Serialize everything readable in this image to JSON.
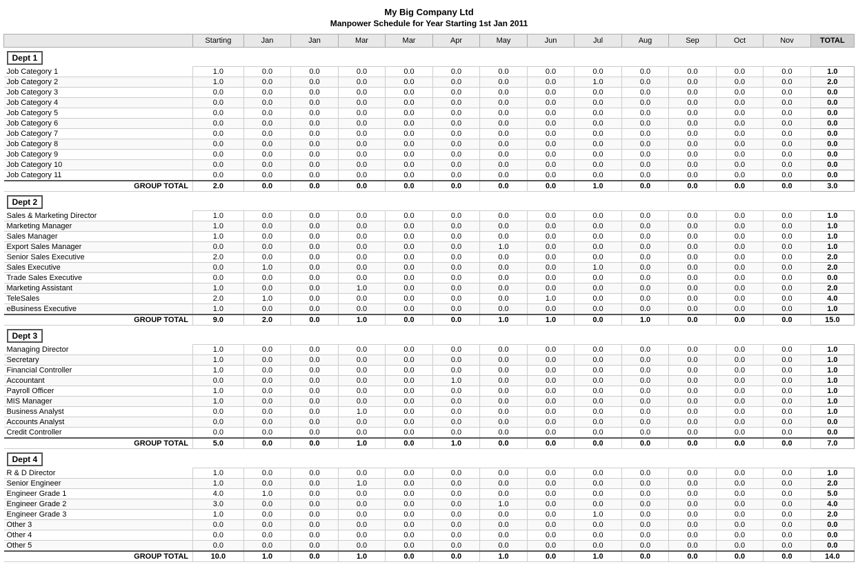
{
  "header": {
    "title": "My Big Company Ltd",
    "subtitle": "Manpower Schedule for Year Starting 1st Jan 2011"
  },
  "columns": [
    "Starting",
    "Jan",
    "Jan",
    "Mar",
    "Mar",
    "Apr",
    "May",
    "Jun",
    "Jul",
    "Aug",
    "Sep",
    "Oct",
    "Nov",
    "TOTAL"
  ],
  "dept1": {
    "name": "Dept 1",
    "rows": [
      {
        "label": "Job Category 1",
        "vals": [
          1.0,
          0.0,
          0.0,
          0.0,
          0.0,
          0.0,
          0.0,
          0.0,
          0.0,
          0.0,
          0.0,
          0.0,
          0.0,
          1.0
        ]
      },
      {
        "label": "Job Category 2",
        "vals": [
          1.0,
          0.0,
          0.0,
          0.0,
          0.0,
          0.0,
          0.0,
          0.0,
          1.0,
          0.0,
          0.0,
          0.0,
          0.0,
          2.0
        ]
      },
      {
        "label": "Job Category 3",
        "vals": [
          0.0,
          0.0,
          0.0,
          0.0,
          0.0,
          0.0,
          0.0,
          0.0,
          0.0,
          0.0,
          0.0,
          0.0,
          0.0,
          0.0
        ]
      },
      {
        "label": "Job Category 4",
        "vals": [
          0.0,
          0.0,
          0.0,
          0.0,
          0.0,
          0.0,
          0.0,
          0.0,
          0.0,
          0.0,
          0.0,
          0.0,
          0.0,
          0.0
        ]
      },
      {
        "label": "Job Category 5",
        "vals": [
          0.0,
          0.0,
          0.0,
          0.0,
          0.0,
          0.0,
          0.0,
          0.0,
          0.0,
          0.0,
          0.0,
          0.0,
          0.0,
          0.0
        ]
      },
      {
        "label": "Job Category 6",
        "vals": [
          0.0,
          0.0,
          0.0,
          0.0,
          0.0,
          0.0,
          0.0,
          0.0,
          0.0,
          0.0,
          0.0,
          0.0,
          0.0,
          0.0
        ]
      },
      {
        "label": "Job Category 7",
        "vals": [
          0.0,
          0.0,
          0.0,
          0.0,
          0.0,
          0.0,
          0.0,
          0.0,
          0.0,
          0.0,
          0.0,
          0.0,
          0.0,
          0.0
        ]
      },
      {
        "label": "Job Category 8",
        "vals": [
          0.0,
          0.0,
          0.0,
          0.0,
          0.0,
          0.0,
          0.0,
          0.0,
          0.0,
          0.0,
          0.0,
          0.0,
          0.0,
          0.0
        ]
      },
      {
        "label": "Job Category 9",
        "vals": [
          0.0,
          0.0,
          0.0,
          0.0,
          0.0,
          0.0,
          0.0,
          0.0,
          0.0,
          0.0,
          0.0,
          0.0,
          0.0,
          0.0
        ]
      },
      {
        "label": "Job Category 10",
        "vals": [
          0.0,
          0.0,
          0.0,
          0.0,
          0.0,
          0.0,
          0.0,
          0.0,
          0.0,
          0.0,
          0.0,
          0.0,
          0.0,
          0.0
        ]
      },
      {
        "label": "Job Category 11",
        "vals": [
          0.0,
          0.0,
          0.0,
          0.0,
          0.0,
          0.0,
          0.0,
          0.0,
          0.0,
          0.0,
          0.0,
          0.0,
          0.0,
          0.0
        ]
      }
    ],
    "total": {
      "label": "GROUP TOTAL",
      "vals": [
        2.0,
        0.0,
        0.0,
        0.0,
        0.0,
        0.0,
        0.0,
        0.0,
        1.0,
        0.0,
        0.0,
        0.0,
        0.0,
        3.0
      ]
    }
  },
  "dept2": {
    "name": "Dept 2",
    "rows": [
      {
        "label": "Sales & Marketing Director",
        "vals": [
          1.0,
          0.0,
          0.0,
          0.0,
          0.0,
          0.0,
          0.0,
          0.0,
          0.0,
          0.0,
          0.0,
          0.0,
          0.0,
          1.0
        ]
      },
      {
        "label": "Marketing Manager",
        "vals": [
          1.0,
          0.0,
          0.0,
          0.0,
          0.0,
          0.0,
          0.0,
          0.0,
          0.0,
          0.0,
          0.0,
          0.0,
          0.0,
          1.0
        ]
      },
      {
        "label": "Sales Manager",
        "vals": [
          1.0,
          0.0,
          0.0,
          0.0,
          0.0,
          0.0,
          0.0,
          0.0,
          0.0,
          0.0,
          0.0,
          0.0,
          0.0,
          1.0
        ]
      },
      {
        "label": "Export Sales Manager",
        "vals": [
          0.0,
          0.0,
          0.0,
          0.0,
          0.0,
          0.0,
          1.0,
          0.0,
          0.0,
          0.0,
          0.0,
          0.0,
          0.0,
          1.0
        ]
      },
      {
        "label": "Senior Sales Executive",
        "vals": [
          2.0,
          0.0,
          0.0,
          0.0,
          0.0,
          0.0,
          0.0,
          0.0,
          0.0,
          0.0,
          0.0,
          0.0,
          0.0,
          2.0
        ]
      },
      {
        "label": "Sales Executive",
        "vals": [
          0.0,
          1.0,
          0.0,
          0.0,
          0.0,
          0.0,
          0.0,
          0.0,
          1.0,
          0.0,
          0.0,
          0.0,
          0.0,
          2.0
        ]
      },
      {
        "label": "Trade Sales Executive",
        "vals": [
          0.0,
          0.0,
          0.0,
          0.0,
          0.0,
          0.0,
          0.0,
          0.0,
          0.0,
          0.0,
          0.0,
          0.0,
          0.0,
          0.0
        ]
      },
      {
        "label": "Marketing Assistant",
        "vals": [
          1.0,
          0.0,
          0.0,
          1.0,
          0.0,
          0.0,
          0.0,
          0.0,
          0.0,
          0.0,
          0.0,
          0.0,
          0.0,
          2.0
        ]
      },
      {
        "label": "TeleSales",
        "vals": [
          2.0,
          1.0,
          0.0,
          0.0,
          0.0,
          0.0,
          0.0,
          1.0,
          0.0,
          0.0,
          0.0,
          0.0,
          0.0,
          4.0
        ]
      },
      {
        "label": "eBusiness Executive",
        "vals": [
          1.0,
          0.0,
          0.0,
          0.0,
          0.0,
          0.0,
          0.0,
          0.0,
          0.0,
          0.0,
          0.0,
          0.0,
          0.0,
          1.0
        ]
      }
    ],
    "total": {
      "label": "GROUP TOTAL",
      "vals": [
        9.0,
        2.0,
        0.0,
        1.0,
        0.0,
        0.0,
        1.0,
        1.0,
        0.0,
        1.0,
        0.0,
        0.0,
        0.0,
        15.0
      ]
    }
  },
  "dept3": {
    "name": "Dept 3",
    "rows": [
      {
        "label": "Managing Director",
        "vals": [
          1.0,
          0.0,
          0.0,
          0.0,
          0.0,
          0.0,
          0.0,
          0.0,
          0.0,
          0.0,
          0.0,
          0.0,
          0.0,
          1.0
        ]
      },
      {
        "label": "Secretary",
        "vals": [
          1.0,
          0.0,
          0.0,
          0.0,
          0.0,
          0.0,
          0.0,
          0.0,
          0.0,
          0.0,
          0.0,
          0.0,
          0.0,
          1.0
        ]
      },
      {
        "label": "Financial Controller",
        "vals": [
          1.0,
          0.0,
          0.0,
          0.0,
          0.0,
          0.0,
          0.0,
          0.0,
          0.0,
          0.0,
          0.0,
          0.0,
          0.0,
          1.0
        ]
      },
      {
        "label": "Accountant",
        "vals": [
          0.0,
          0.0,
          0.0,
          0.0,
          0.0,
          1.0,
          0.0,
          0.0,
          0.0,
          0.0,
          0.0,
          0.0,
          0.0,
          1.0
        ]
      },
      {
        "label": "Payroll Officer",
        "vals": [
          1.0,
          0.0,
          0.0,
          0.0,
          0.0,
          0.0,
          0.0,
          0.0,
          0.0,
          0.0,
          0.0,
          0.0,
          0.0,
          1.0
        ]
      },
      {
        "label": "MIS Manager",
        "vals": [
          1.0,
          0.0,
          0.0,
          0.0,
          0.0,
          0.0,
          0.0,
          0.0,
          0.0,
          0.0,
          0.0,
          0.0,
          0.0,
          1.0
        ]
      },
      {
        "label": "Business Analyst",
        "vals": [
          0.0,
          0.0,
          0.0,
          1.0,
          0.0,
          0.0,
          0.0,
          0.0,
          0.0,
          0.0,
          0.0,
          0.0,
          0.0,
          1.0
        ]
      },
      {
        "label": "Accounts Analyst",
        "vals": [
          0.0,
          0.0,
          0.0,
          0.0,
          0.0,
          0.0,
          0.0,
          0.0,
          0.0,
          0.0,
          0.0,
          0.0,
          0.0,
          0.0
        ]
      },
      {
        "label": "Credit Controller",
        "vals": [
          0.0,
          0.0,
          0.0,
          0.0,
          0.0,
          0.0,
          0.0,
          0.0,
          0.0,
          0.0,
          0.0,
          0.0,
          0.0,
          0.0
        ]
      }
    ],
    "total": {
      "label": "GROUP TOTAL",
      "vals": [
        5.0,
        0.0,
        0.0,
        1.0,
        0.0,
        1.0,
        0.0,
        0.0,
        0.0,
        0.0,
        0.0,
        0.0,
        0.0,
        7.0
      ]
    }
  },
  "dept4": {
    "name": "Dept 4",
    "rows": [
      {
        "label": "R & D Director",
        "vals": [
          1.0,
          0.0,
          0.0,
          0.0,
          0.0,
          0.0,
          0.0,
          0.0,
          0.0,
          0.0,
          0.0,
          0.0,
          0.0,
          1.0
        ]
      },
      {
        "label": "Senior Engineer",
        "vals": [
          1.0,
          0.0,
          0.0,
          1.0,
          0.0,
          0.0,
          0.0,
          0.0,
          0.0,
          0.0,
          0.0,
          0.0,
          0.0,
          2.0
        ]
      },
      {
        "label": "Engineer Grade 1",
        "vals": [
          4.0,
          1.0,
          0.0,
          0.0,
          0.0,
          0.0,
          0.0,
          0.0,
          0.0,
          0.0,
          0.0,
          0.0,
          0.0,
          5.0
        ]
      },
      {
        "label": "Engineer Grade 2",
        "vals": [
          3.0,
          0.0,
          0.0,
          0.0,
          0.0,
          0.0,
          1.0,
          0.0,
          0.0,
          0.0,
          0.0,
          0.0,
          0.0,
          4.0
        ]
      },
      {
        "label": "Engineer Grade 3",
        "vals": [
          1.0,
          0.0,
          0.0,
          0.0,
          0.0,
          0.0,
          0.0,
          0.0,
          1.0,
          0.0,
          0.0,
          0.0,
          0.0,
          2.0
        ]
      },
      {
        "label": "Other 3",
        "vals": [
          0.0,
          0.0,
          0.0,
          0.0,
          0.0,
          0.0,
          0.0,
          0.0,
          0.0,
          0.0,
          0.0,
          0.0,
          0.0,
          0.0
        ]
      },
      {
        "label": "Other 4",
        "vals": [
          0.0,
          0.0,
          0.0,
          0.0,
          0.0,
          0.0,
          0.0,
          0.0,
          0.0,
          0.0,
          0.0,
          0.0,
          0.0,
          0.0
        ]
      },
      {
        "label": "Other 5",
        "vals": [
          0.0,
          0.0,
          0.0,
          0.0,
          0.0,
          0.0,
          0.0,
          0.0,
          0.0,
          0.0,
          0.0,
          0.0,
          0.0,
          0.0
        ]
      }
    ],
    "total": {
      "label": "GROUP TOTAL",
      "vals": [
        10.0,
        1.0,
        0.0,
        1.0,
        0.0,
        0.0,
        1.0,
        0.0,
        1.0,
        0.0,
        0.0,
        0.0,
        0.0,
        14.0
      ]
    }
  }
}
